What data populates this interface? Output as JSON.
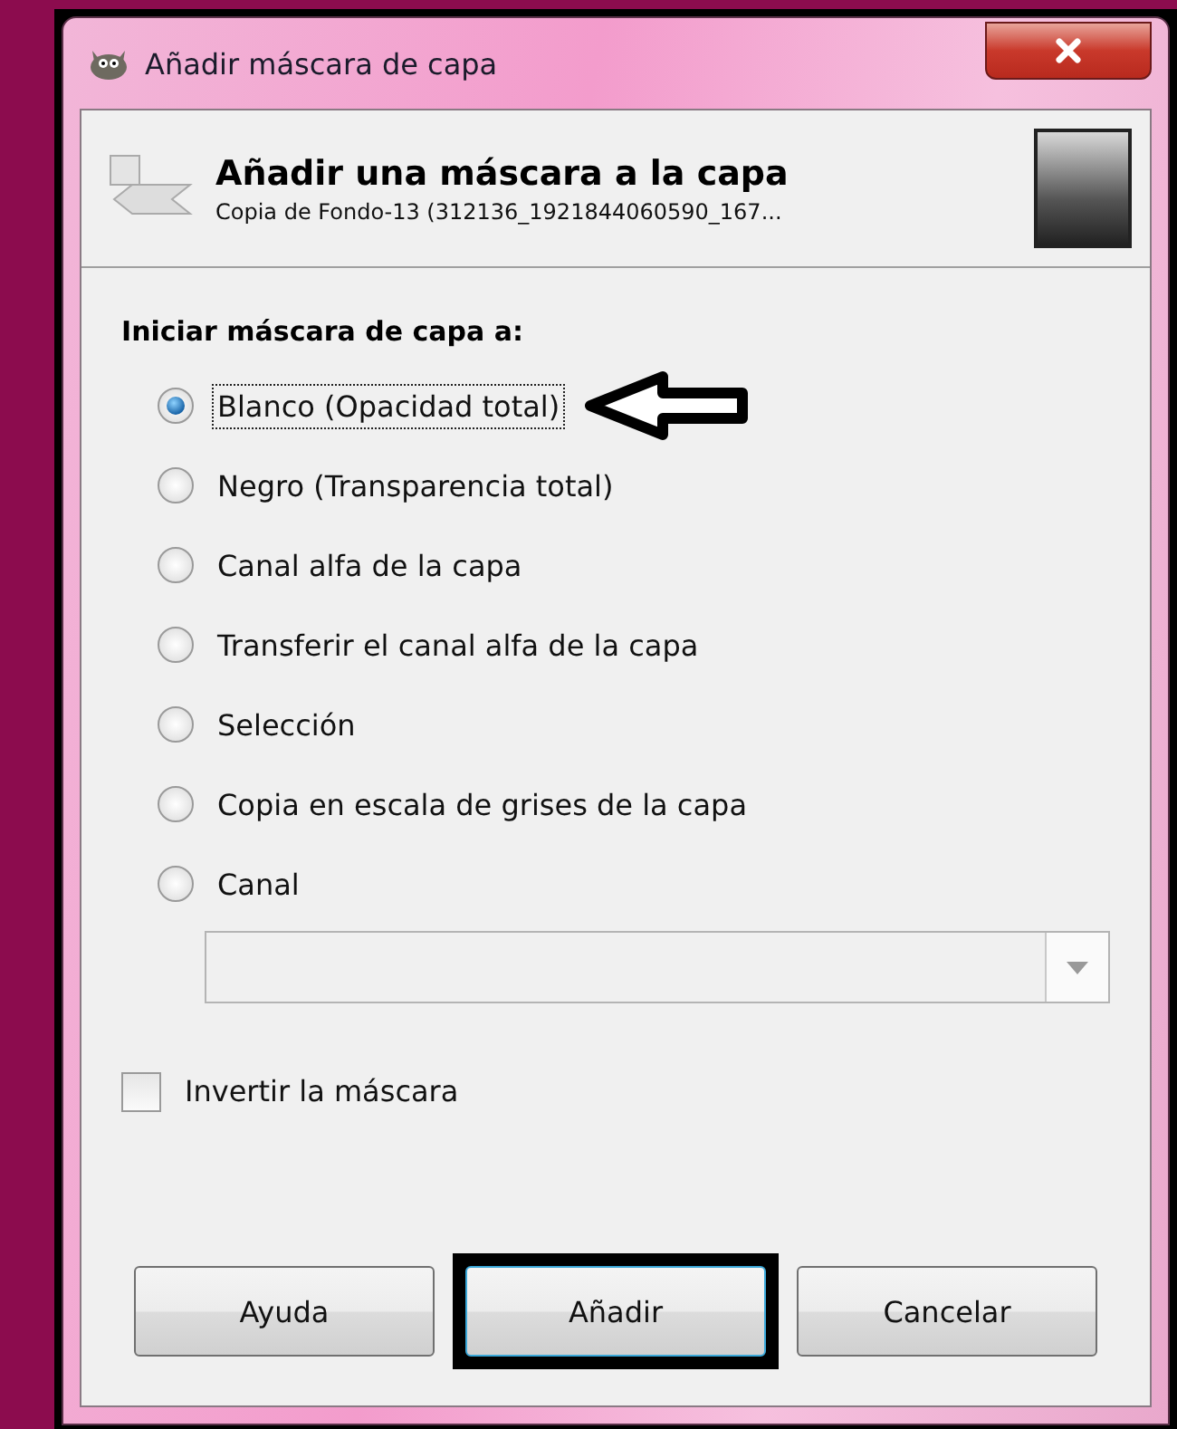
{
  "window": {
    "title": "Añadir máscara de capa"
  },
  "header": {
    "title": "Añadir una máscara a la capa",
    "subtitle": "Copia de Fondo-13 (312136_1921844060590_167..."
  },
  "section_label": "Iniciar máscara de capa a:",
  "options": [
    {
      "label": "Blanco (Opacidad total)",
      "selected": true,
      "focused": true,
      "annotated": true
    },
    {
      "label": "Negro (Transparencia total)",
      "selected": false,
      "focused": false,
      "annotated": false
    },
    {
      "label": "Canal alfa de la capa",
      "selected": false,
      "focused": false,
      "annotated": false
    },
    {
      "label": "Transferir el canal alfa de la capa",
      "selected": false,
      "focused": false,
      "annotated": false
    },
    {
      "label": "Selección",
      "selected": false,
      "focused": false,
      "annotated": false
    },
    {
      "label": "Copia en escala de grises de la capa",
      "selected": false,
      "focused": false,
      "annotated": false
    },
    {
      "label": "Canal",
      "selected": false,
      "focused": false,
      "annotated": false
    }
  ],
  "invert": {
    "label": "Invertir la máscara",
    "checked": false
  },
  "buttons": [
    {
      "label": "Ayuda",
      "default": false,
      "highlighted": false
    },
    {
      "label": "Añadir",
      "default": true,
      "highlighted": true
    },
    {
      "label": "Cancelar",
      "default": false,
      "highlighted": false
    }
  ]
}
